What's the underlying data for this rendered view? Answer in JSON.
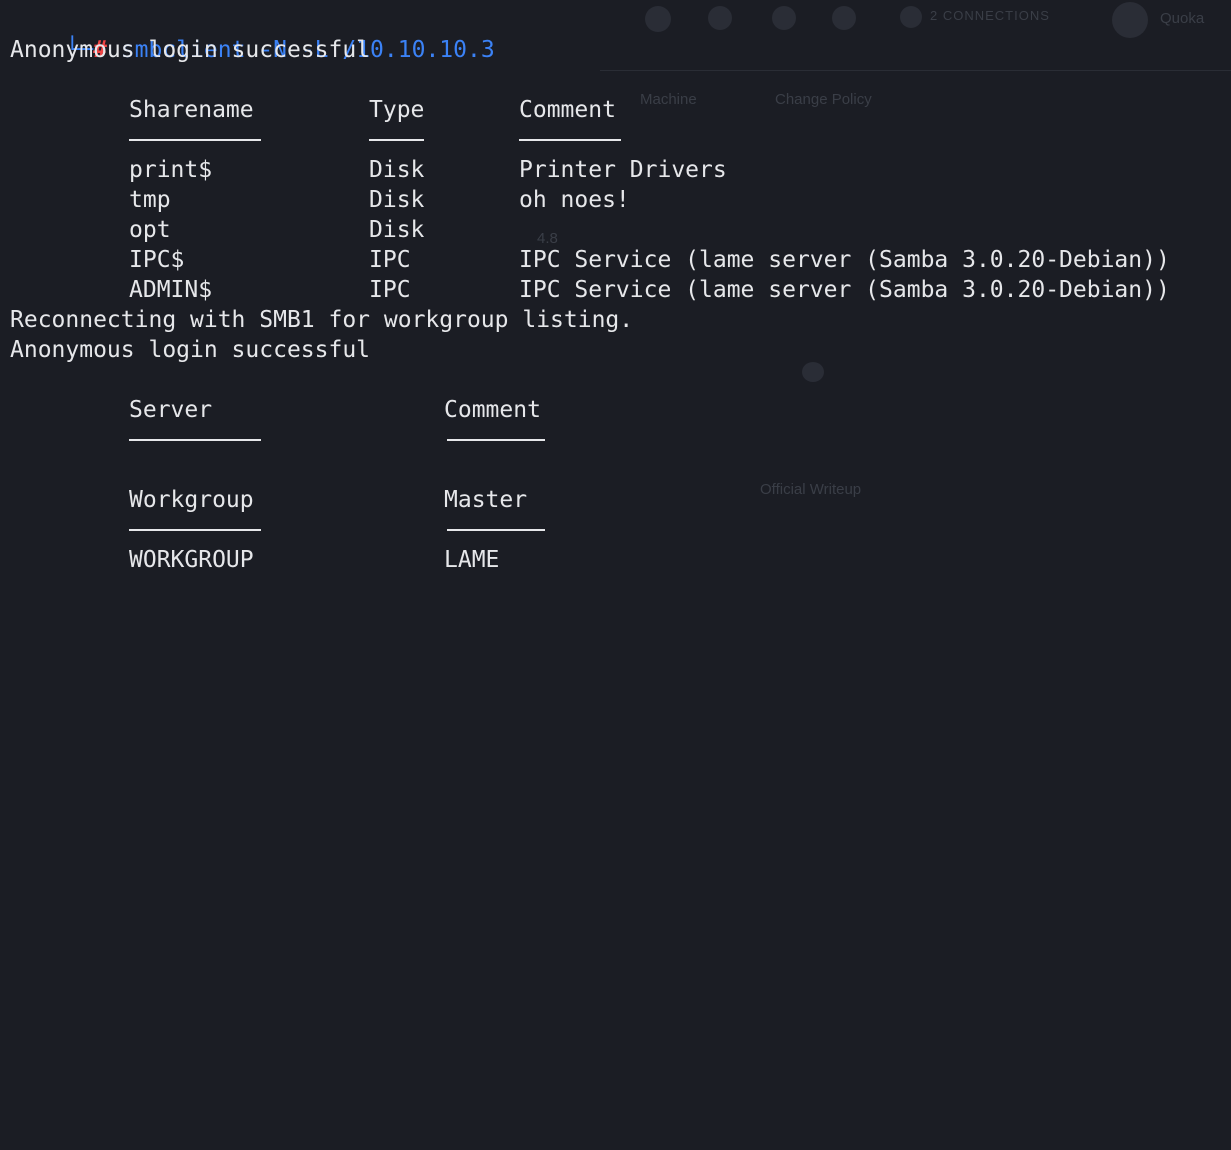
{
  "background_page": {
    "nav_connections": "2 CONNECTIONS",
    "nav_user": "Quoka",
    "tab_machine": "Machine",
    "tab_changelog": "Change Policy",
    "stat_value": "4.8",
    "writeup_label": "Official Writeup"
  },
  "terminal": {
    "prompt_corner": "└─",
    "prompt_hash": "#",
    "command": "smbclient -N -L /10.10.10.3",
    "login_msg_1": "Anonymous login successful",
    "share_table": {
      "headers": [
        "Sharename",
        "Type",
        "Comment"
      ],
      "rows": [
        [
          "print$",
          "Disk",
          "Printer Drivers"
        ],
        [
          "tmp",
          "Disk",
          "oh noes!"
        ],
        [
          "opt",
          "Disk",
          ""
        ],
        [
          "IPC$",
          "IPC",
          "IPC Service (lame server (Samba 3.0.20-Debian))"
        ],
        [
          "ADMIN$",
          "IPC",
          "IPC Service (lame server (Samba 3.0.20-Debian))"
        ]
      ]
    },
    "reconnect_msg": "Reconnecting with SMB1 for workgroup listing.",
    "login_msg_2": "Anonymous login successful",
    "server_table": {
      "headers": [
        "Server",
        "Comment"
      ]
    },
    "workgroup_table": {
      "headers": [
        "Workgroup",
        "Master"
      ],
      "rows": [
        [
          "WORKGROUP",
          "LAME"
        ]
      ]
    }
  },
  "colors": {
    "background": "#1b1d24",
    "text": "#e6e7ea",
    "prompt_blue": "#3b82f6",
    "prompt_red": "#ef4444"
  }
}
